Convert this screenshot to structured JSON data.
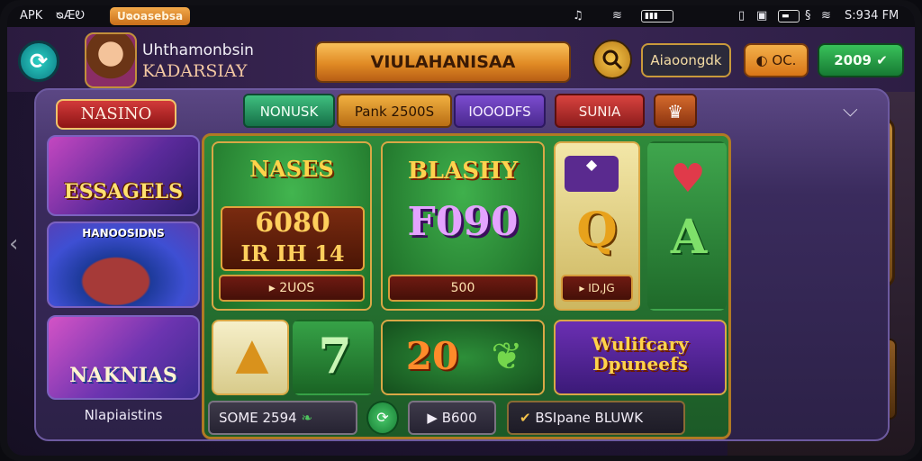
{
  "status_bar": {
    "left_label": "APK",
    "left_icons_text": "ᴓÆᎧ",
    "badge": "Uᴓoasebsa",
    "time": "S:934 FM"
  },
  "header": {
    "user_name": "Uhthamonbsin",
    "user_sub": "KADARSIAY",
    "title": "VIULAHANISAA",
    "account_button": "Aiaoongdk",
    "coins": "OC.",
    "cash": "2009"
  },
  "nav": {
    "casino_label": "NASINO",
    "tabs": [
      "NONUSK",
      "Pank 2500S",
      "IOOODFS",
      "SUNIA"
    ]
  },
  "side_cards": [
    {
      "title": "ESSAGELS"
    },
    {
      "title": "HANOOSIDNS"
    },
    {
      "title": "NAKNIAS"
    }
  ],
  "side_caption": "Nlapiaistins",
  "slots": {
    "s1": {
      "title": "NASES",
      "num_top": "6080",
      "num_bottom": "IR IH 14",
      "bar": "2UOS"
    },
    "s2": {
      "title": "BLASHY",
      "num": "F090",
      "bar": "500"
    },
    "s3": {
      "symbol": "Q",
      "bar": "ID,JG"
    },
    "s4": {
      "symbol": "A"
    },
    "s6": {
      "symbol": "7"
    },
    "s7": {
      "num": "20"
    },
    "s8": {
      "title": "Wulifcary Dpuneefs"
    }
  },
  "controls": {
    "c1": "SOME 2594",
    "c2": "B600",
    "c3": "BSIpane BLUWK"
  },
  "scene": {
    "reels": [
      "30",
      "30"
    ]
  },
  "colors": {
    "accent": "#e08a24",
    "cash": "#38c15a",
    "panel": "#3a2b5d"
  }
}
